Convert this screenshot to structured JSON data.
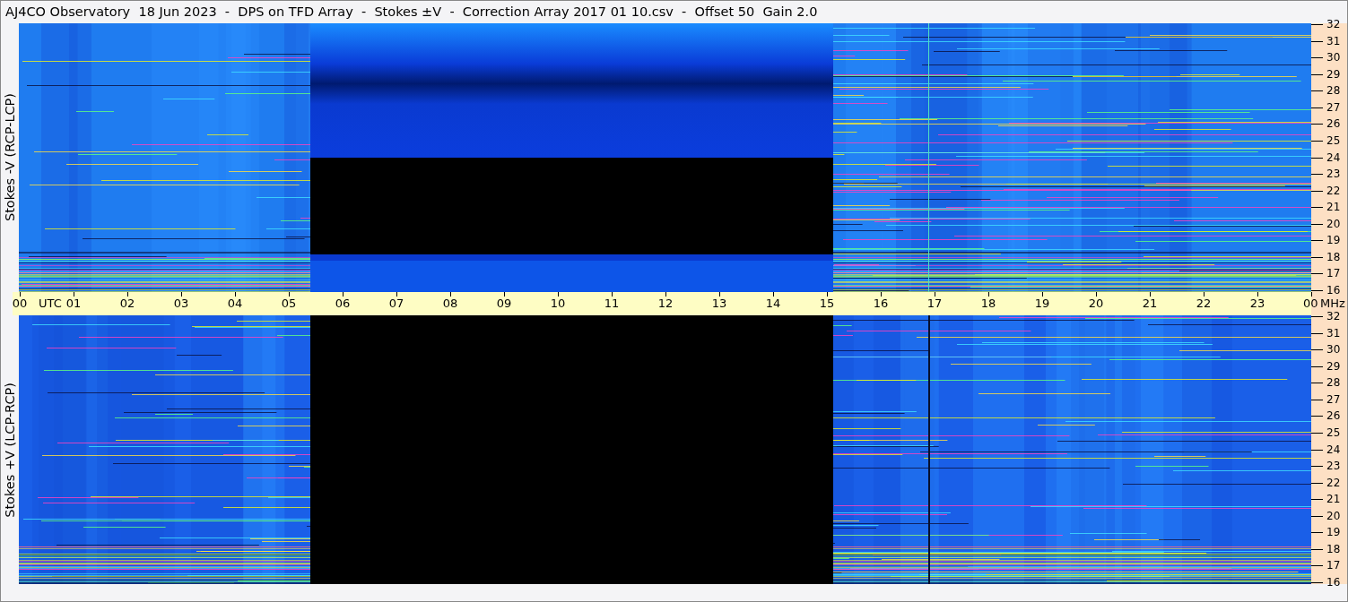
{
  "title": "AJ4CO Observatory  18 Jun 2023  -  DPS on TFD Array  -  Stokes ±V  -  Correction Array 2017 01 10.csv  -  Offset 50  Gain 2.0",
  "panels": [
    {
      "label": "Stokes -V (RCP-LCP)",
      "freq_ticks": [
        "32",
        "31",
        "30",
        "29",
        "28",
        "27",
        "26",
        "25",
        "24",
        "23",
        "22",
        "21",
        "20",
        "19",
        "18",
        "17",
        "16"
      ]
    },
    {
      "label": "Stokes +V (LCP-RCP)",
      "freq_ticks": [
        "32",
        "31",
        "30",
        "29",
        "28",
        "27",
        "26",
        "25",
        "24",
        "23",
        "22",
        "21",
        "20",
        "19",
        "18",
        "17",
        "16"
      ]
    }
  ],
  "time_axis": {
    "ticks": [
      "00",
      "01",
      "02",
      "03",
      "04",
      "05",
      "06",
      "07",
      "08",
      "09",
      "10",
      "11",
      "12",
      "13",
      "14",
      "15",
      "16",
      "17",
      "18",
      "19",
      "20",
      "21",
      "22",
      "23",
      "00"
    ],
    "time_unit": "UTC",
    "freq_unit": "MHz"
  }
}
